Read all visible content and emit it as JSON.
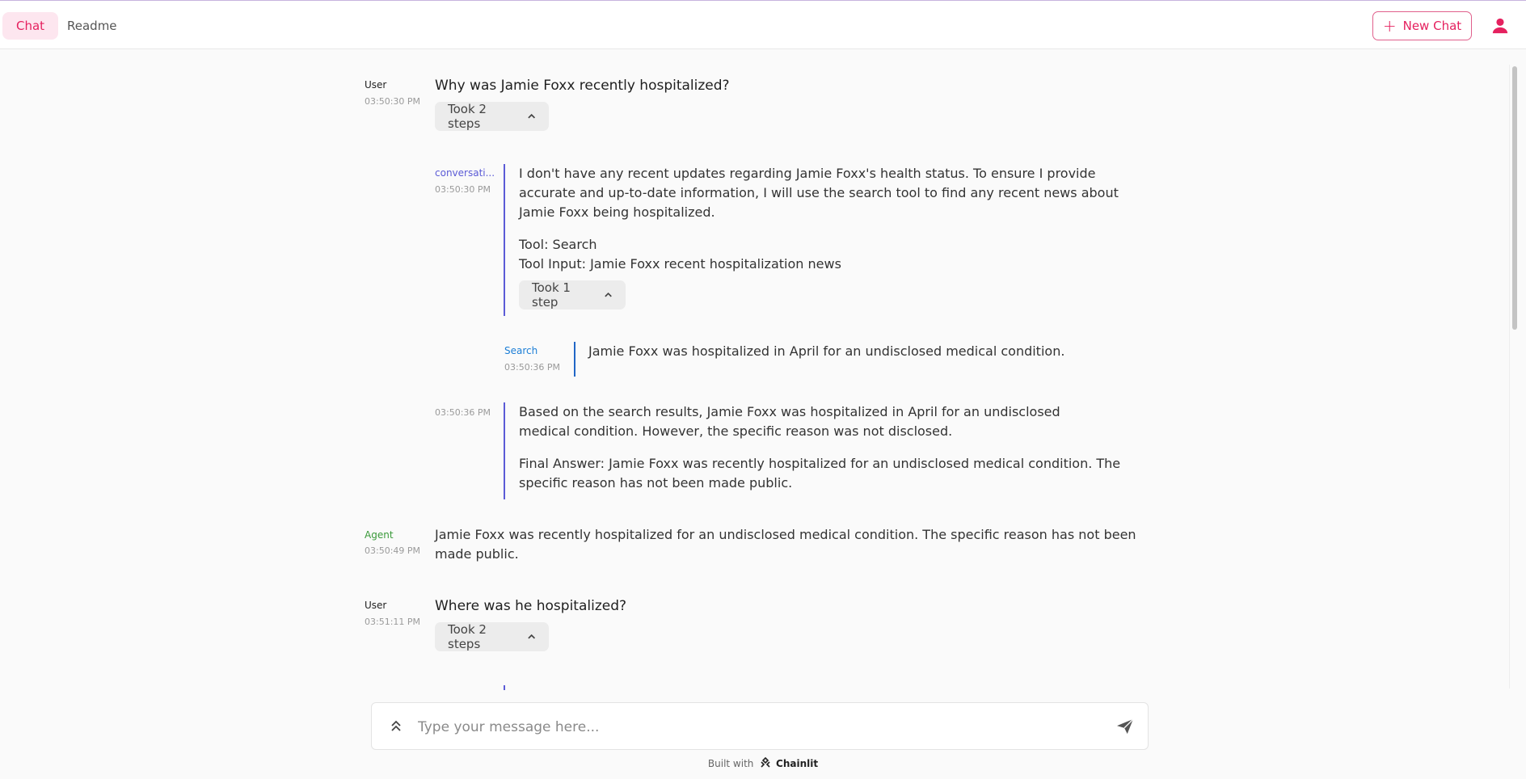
{
  "header": {
    "tabs": [
      {
        "label": "Chat"
      },
      {
        "label": "Readme"
      }
    ],
    "new_chat_label": "New Chat"
  },
  "messages": {
    "m1": {
      "author": "User",
      "time": "03:50:30 PM",
      "text": "Why was Jamie Foxx recently hospitalized?",
      "steps_label": "Took 2 steps"
    },
    "m2": {
      "author": "conversati...",
      "time": "03:50:30 PM",
      "p1": "I don't have any recent updates regarding Jamie Foxx's health status. To ensure I provide accurate and up-to-date information, I will use the search tool to find any recent news about Jamie Foxx being hospitalized.",
      "p2": "Tool: Search",
      "p3": "Tool Input: Jamie Foxx recent hospitalization news",
      "steps_label": "Took 1 step"
    },
    "m3": {
      "author": "Search",
      "time": "03:50:36 PM",
      "text": "Jamie Foxx was hospitalized in April for an undisclosed medical condition."
    },
    "m4": {
      "time": "03:50:36 PM",
      "p1": "Based on the search results, Jamie Foxx was hospitalized in April for an undisclosed medical condition. However, the specific reason was not disclosed.",
      "p2": "Final Answer: Jamie Foxx was recently hospitalized for an undisclosed medical condition. The specific reason has not been made public."
    },
    "m5": {
      "author": "Agent",
      "time": "03:50:49 PM",
      "text": "Jamie Foxx was recently hospitalized for an undisclosed medical condition. The specific reason has not been made public."
    },
    "m6": {
      "author": "User",
      "time": "03:51:11 PM",
      "text": "Where was he hospitalized?",
      "steps_label": "Took 2 steps"
    }
  },
  "composer": {
    "placeholder": "Type your message here..."
  },
  "footer": {
    "built_with": "Built with",
    "brand": "Chainlit"
  },
  "colors": {
    "accent": "#e5215f",
    "conversation": "#5b5bd6",
    "search": "#1c7ed6",
    "agent": "#3a9a3a"
  }
}
